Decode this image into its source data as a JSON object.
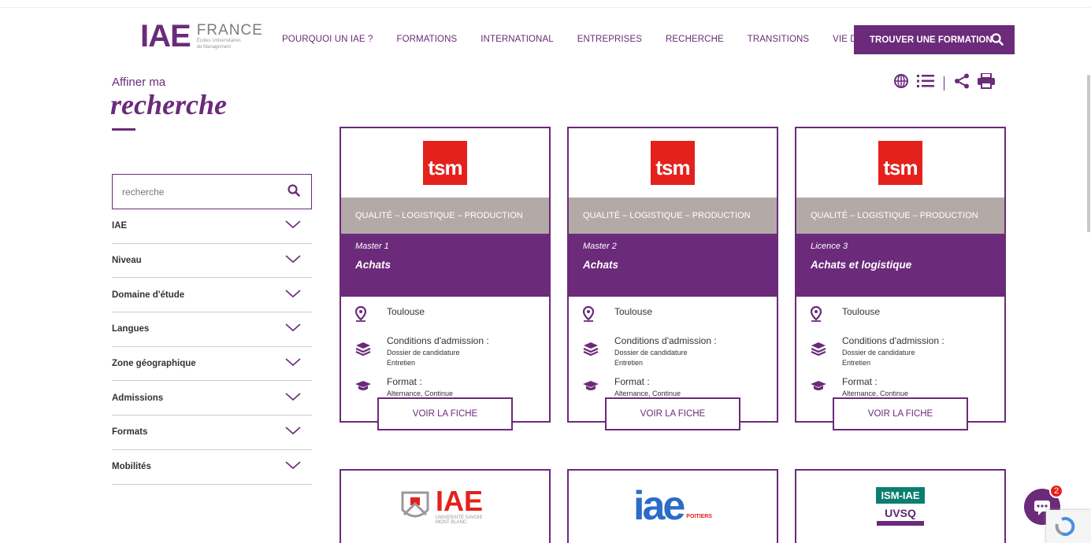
{
  "header": {
    "logo_brand": "IAE",
    "logo_country": "FRANCE",
    "logo_subtitle_1": "Écoles Universitaires",
    "logo_subtitle_2": "de Management",
    "nav": [
      "POURQUOI UN IAE ?",
      "FORMATIONS",
      "INTERNATIONAL",
      "ENTREPRISES",
      "RECHERCHE",
      "TRANSITIONS",
      "VIE DU RÉSEAU"
    ],
    "cta_label": "TROUVER UNE FORMATION"
  },
  "sidebar": {
    "affiner": "Affiner ma",
    "title": "recherche",
    "search_placeholder": "recherche",
    "filters": [
      "IAE",
      "Niveau",
      "Domaine d'étude",
      "Langues",
      "Zone géographique",
      "Admissions",
      "Formats",
      "Mobilités"
    ]
  },
  "cards": [
    {
      "logo": "tsm",
      "domain": "QUALITÉ – LOGISTIQUE – PRODUCTION",
      "level": "Master 1",
      "name": "Achats",
      "city": "Toulouse",
      "admission_title": "Conditions d'admission :",
      "admission_1": "Dossier de candidature",
      "admission_2": "Entretien",
      "format_title": "Format :",
      "format_value": "Alternance, Continue",
      "button": "VOIR LA FICHE"
    },
    {
      "logo": "tsm",
      "domain": "QUALITÉ – LOGISTIQUE – PRODUCTION",
      "level": "Master 2",
      "name": "Achats",
      "city": "Toulouse",
      "admission_title": "Conditions d'admission :",
      "admission_1": "Dossier de candidature",
      "admission_2": "Entretien",
      "format_title": "Format :",
      "format_value": "Alternance, Continue",
      "button": "VOIR LA FICHE"
    },
    {
      "logo": "tsm",
      "domain": "QUALITÉ – LOGISTIQUE – PRODUCTION",
      "level": "Licence 3",
      "name": "Achats et logistique",
      "city": "Toulouse",
      "admission_title": "Conditions d'admission :",
      "admission_1": "Dossier de candidature",
      "admission_2": "Entretien",
      "format_title": "Format :",
      "format_value": "Alternance, Continue",
      "button": "VOIR LA FICHE"
    }
  ],
  "bottom_cards": [
    {
      "logo_text": "IAE",
      "logo_sub": "UNIVERSITÉ SAVOIE MONT BLANC"
    },
    {
      "logo_text": "iae",
      "logo_sub": "POITIERS"
    },
    {
      "logo_text": "ISM-IAE",
      "logo_sub": "UVSQ"
    }
  ],
  "chat": {
    "badge_count": "2"
  },
  "colors": {
    "brand": "#6b2a7a",
    "tsm_red": "#e4211c",
    "domain_bar": "#b3aaa7"
  }
}
